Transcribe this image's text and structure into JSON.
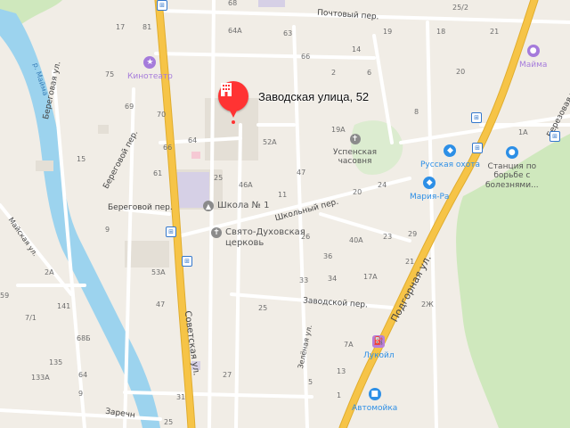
{
  "place": {
    "address": "Заводская улица, 52"
  },
  "colors": {
    "background": "#f1ede6",
    "river": "#9cd3ee",
    "forest": "#cfe8bd",
    "major_road": "#f6c447",
    "pin": "#ff3333",
    "poi_purple": "#a57bdb",
    "poi_blue": "#2d8fe6",
    "poi_gray": "#8b8b8b",
    "fuel": "#b87fd8"
  },
  "river": {
    "name": "р. Майма"
  },
  "streets": {
    "sovetskaya": "Советская ул.",
    "pochtovy": "Почтовый пер.",
    "beregovaya_left": "Береговая ул.",
    "beregovoy_per_1": "Береговой пер.",
    "beregovoy_per_2": "Береговой пер.",
    "shkolny": "Школьный пер.",
    "zavodskoy": "Заводской пер.",
    "podgornaya": "Подгорная ул.",
    "zelenaya": "Зелёная ул.",
    "maiskaya": "Майская ул.",
    "berezovaya": "Березовая ул.",
    "zarechnaya": "Заречн"
  },
  "pois": {
    "kinoteatr": {
      "name": "Кинотеатр",
      "icon": "theater-icon"
    },
    "school": {
      "name": "Школа № 1",
      "icon": "school-icon"
    },
    "church": {
      "name": "Свято-Духовская\nцерковь",
      "icon": "church-cross-icon"
    },
    "chasovnya": {
      "name": "Успенская\nчасовня",
      "icon": "church-cross-icon"
    },
    "russkaya_okhota": {
      "name": "Русская охота",
      "icon": "shopping-bag-icon"
    },
    "mariya_ra": {
      "name": "Мария-Ра",
      "icon": "shopping-bag-icon"
    },
    "stantsiya": {
      "name": "Станция по\nборьбе с\nболезнями...",
      "icon": "paw-icon"
    },
    "maima": {
      "name": "Майма",
      "icon": "paw-icon"
    },
    "lukoil": {
      "name": "Лукойл",
      "icon": "fuel-icon"
    },
    "avtomoyka": {
      "name": "Автомойка",
      "icon": "car-wash-icon"
    }
  },
  "house_numbers": {
    "h1": "68",
    "h2": "25/2",
    "h3": "17",
    "h4": "81",
    "h5": "64А",
    "h6": "63",
    "h7": "19",
    "h8": "18",
    "h9": "21",
    "h10": "75",
    "h11": "14",
    "h12": "66",
    "h13": "2",
    "h14": "6",
    "h15": "20",
    "h16": "69",
    "h17": "70",
    "h18": "8",
    "h19": "19А",
    "h20": "1А",
    "h21": "66",
    "h22": "64",
    "h23": "52А",
    "h24": "15",
    "h25": "61",
    "h26": "47",
    "h27": "25",
    "h28": "46А",
    "h29": "11",
    "h30": "20",
    "h31": "24",
    "h32": "9",
    "h33": "26",
    "h34": "40А",
    "h35": "23",
    "h36": "29",
    "h37": "53А",
    "h38": "36",
    "h39": "21",
    "h40": "17А",
    "h41": "2А",
    "h42": "59",
    "h43": "47",
    "h44": "33",
    "h45": "34",
    "h46": "141",
    "h47": "7/1",
    "h48": "25",
    "h49": "2Ж",
    "h50": "68Б",
    "h51": "7А",
    "h52": "135",
    "h53": "133А",
    "h54": "64",
    "h55": "31",
    "h56": "25",
    "h57": "27",
    "h58": "13",
    "h59": "5",
    "h60": "1",
    "h61": "9"
  }
}
